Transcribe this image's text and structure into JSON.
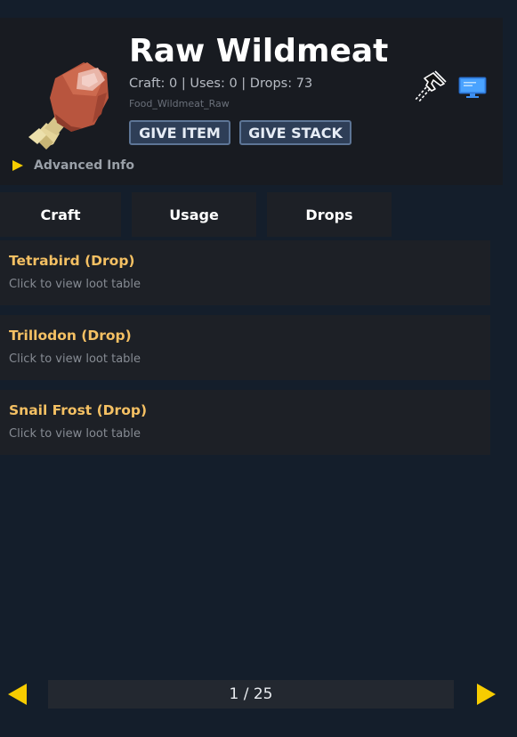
{
  "header": {
    "title": "Raw Wildmeat",
    "stats": "Craft: 0 | Uses: 0 | Drops: 73",
    "item_id": "Food_Wildmeat_Raw",
    "give_item_label": "GIVE ITEM",
    "give_stack_label": "GIVE STACK",
    "advanced_label": "Advanced Info",
    "icons": [
      "raw-wildmeat-item-icon",
      "pin-icon",
      "monitor-icon",
      "triangle-right-icon"
    ]
  },
  "tabs": [
    {
      "label": "Craft"
    },
    {
      "label": "Usage"
    },
    {
      "label": "Drops"
    }
  ],
  "drops": [
    {
      "name": "Tetrabird (Drop)",
      "hint": "Click to view loot table"
    },
    {
      "name": "Trillodon (Drop)",
      "hint": "Click to view loot table"
    },
    {
      "name": "Snail Frost (Drop)",
      "hint": "Click to view loot table"
    }
  ],
  "pagination": {
    "text": "1 / 25",
    "prev_icon": "arrow-left-icon",
    "next_icon": "arrow-right-icon"
  },
  "colors": {
    "background": "#141e2b",
    "panel": "#181b21",
    "card": "#1d2026",
    "accent_gold": "#f4c063",
    "arrow_yellow": "#f7cc00",
    "button_bg": "#2e3e57",
    "button_border": "#5d7596"
  }
}
